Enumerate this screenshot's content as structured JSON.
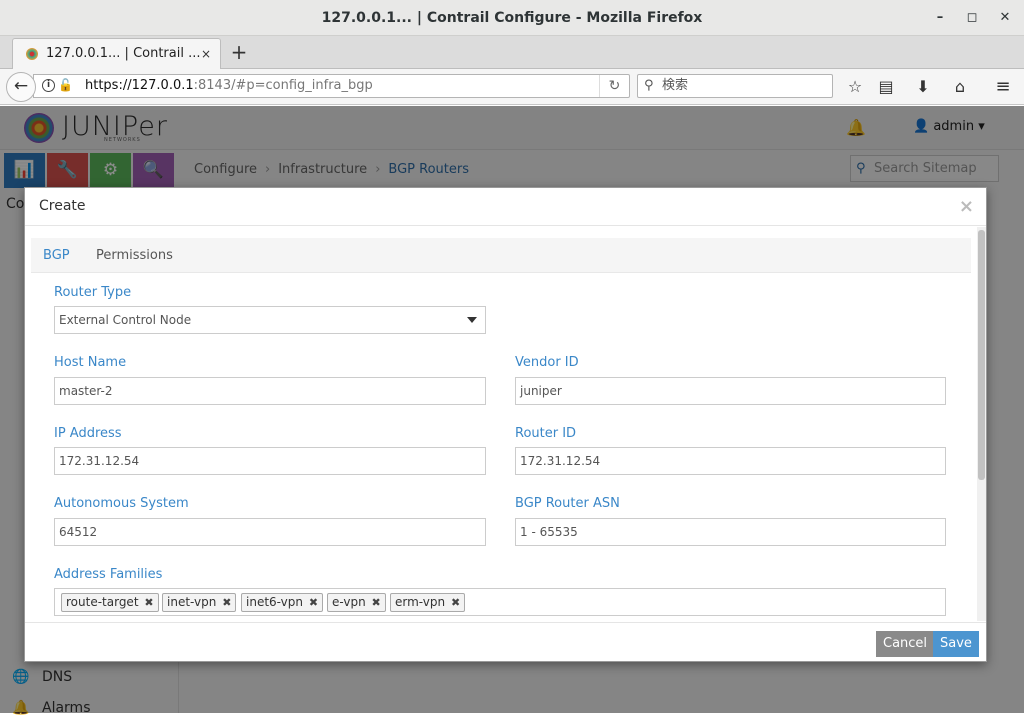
{
  "window": {
    "title": "127.0.0.1... | Contrail Configure - Mozilla Firefox",
    "min": "–",
    "max": "◻",
    "close": "✕"
  },
  "tab": {
    "label": "127.0.0.1... | Contrail ...",
    "close": "×",
    "new": "+"
  },
  "nav": {
    "url_host": "https://127.0.0.1",
    "url_rest": ":8143/#p=config_infra_bgp",
    "search_placeholder": "検索"
  },
  "app": {
    "logo": "JUNIPer",
    "logo_sub": "NETWORKS",
    "user": "admin",
    "breadcrumb": [
      "Configure",
      "Infrastructure",
      "BGP Routers"
    ],
    "sitemap_placeholder": "Search Sitemap",
    "sidebar": [
      {
        "icon": "globe-icon",
        "glyph": "🌐",
        "label": "DNS"
      },
      {
        "icon": "bell-icon",
        "glyph": "🔔",
        "label": "Alarms"
      }
    ],
    "sidebar_partial": "Co"
  },
  "modal": {
    "title": "Create",
    "tabs": [
      "BGP",
      "Permissions"
    ],
    "router_type": {
      "label": "Router Type",
      "value": "External Control Node"
    },
    "host_name": {
      "label": "Host Name",
      "value": "master-2"
    },
    "vendor_id": {
      "label": "Vendor ID",
      "value": "juniper"
    },
    "ip_address": {
      "label": "IP Address",
      "value": "172.31.12.54"
    },
    "router_id": {
      "label": "Router ID",
      "value": "172.31.12.54"
    },
    "autonomous_system": {
      "label": "Autonomous System",
      "value": "64512"
    },
    "bgp_router_asn": {
      "label": "BGP Router ASN",
      "placeholder": "1 - 65535"
    },
    "address_families": {
      "label": "Address Families",
      "chips": [
        "route-target",
        "inet-vpn",
        "inet6-vpn",
        "e-vpn",
        "erm-vpn"
      ]
    },
    "cancel": "Cancel",
    "save": "Save"
  },
  "colors": {
    "accent": "#3a87c8",
    "save": "#4c95d0",
    "cancel": "#8a8a8a"
  }
}
